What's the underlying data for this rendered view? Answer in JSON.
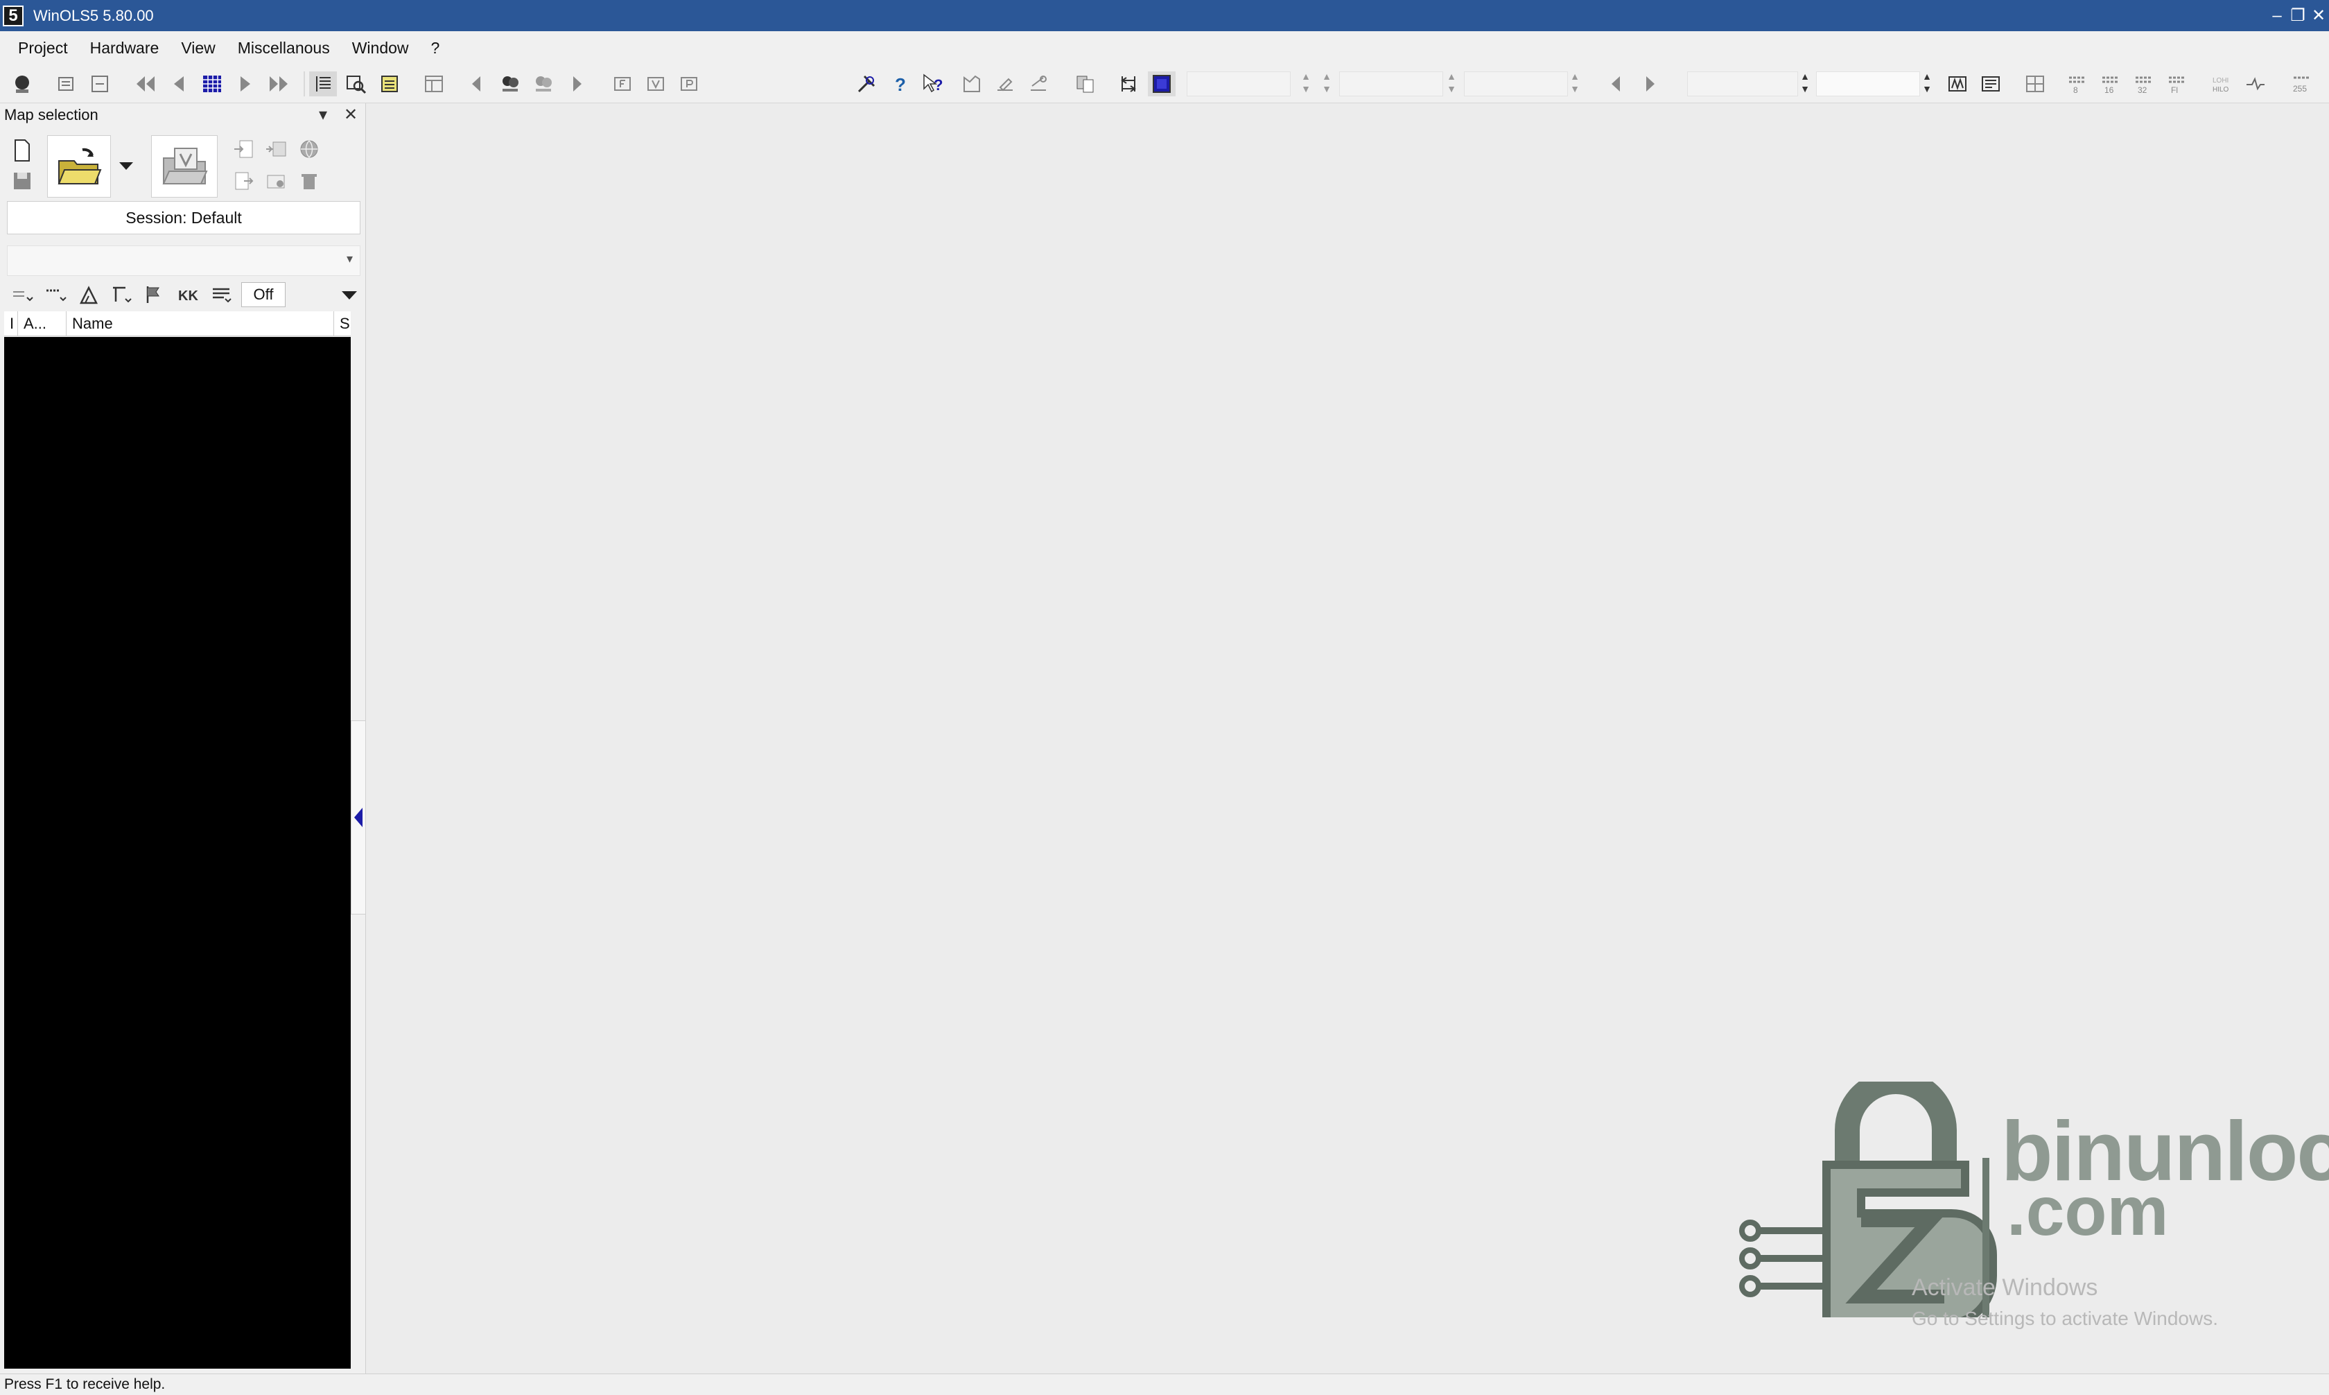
{
  "window": {
    "title": "WinOLS5 5.80.00",
    "logo_text": "5"
  },
  "menu": {
    "items": [
      "Project",
      "Hardware",
      "View",
      "Miscellanous",
      "Window",
      "?"
    ]
  },
  "panel": {
    "title": "Map selection",
    "session_label": "Session: Default",
    "off_label": "Off",
    "columns": [
      "I",
      "A...",
      "Name",
      "S"
    ]
  },
  "watermark": {
    "line1": "binunlock",
    "line2": ".com"
  },
  "activation": {
    "title": "Activate Windows",
    "subtitle": "Go to Settings to activate Windows."
  },
  "status": {
    "text": "Press F1 to receive help."
  },
  "colors": {
    "titlebar": "#2b5797",
    "background": "#ececec",
    "accent": "#1c1ca8"
  }
}
